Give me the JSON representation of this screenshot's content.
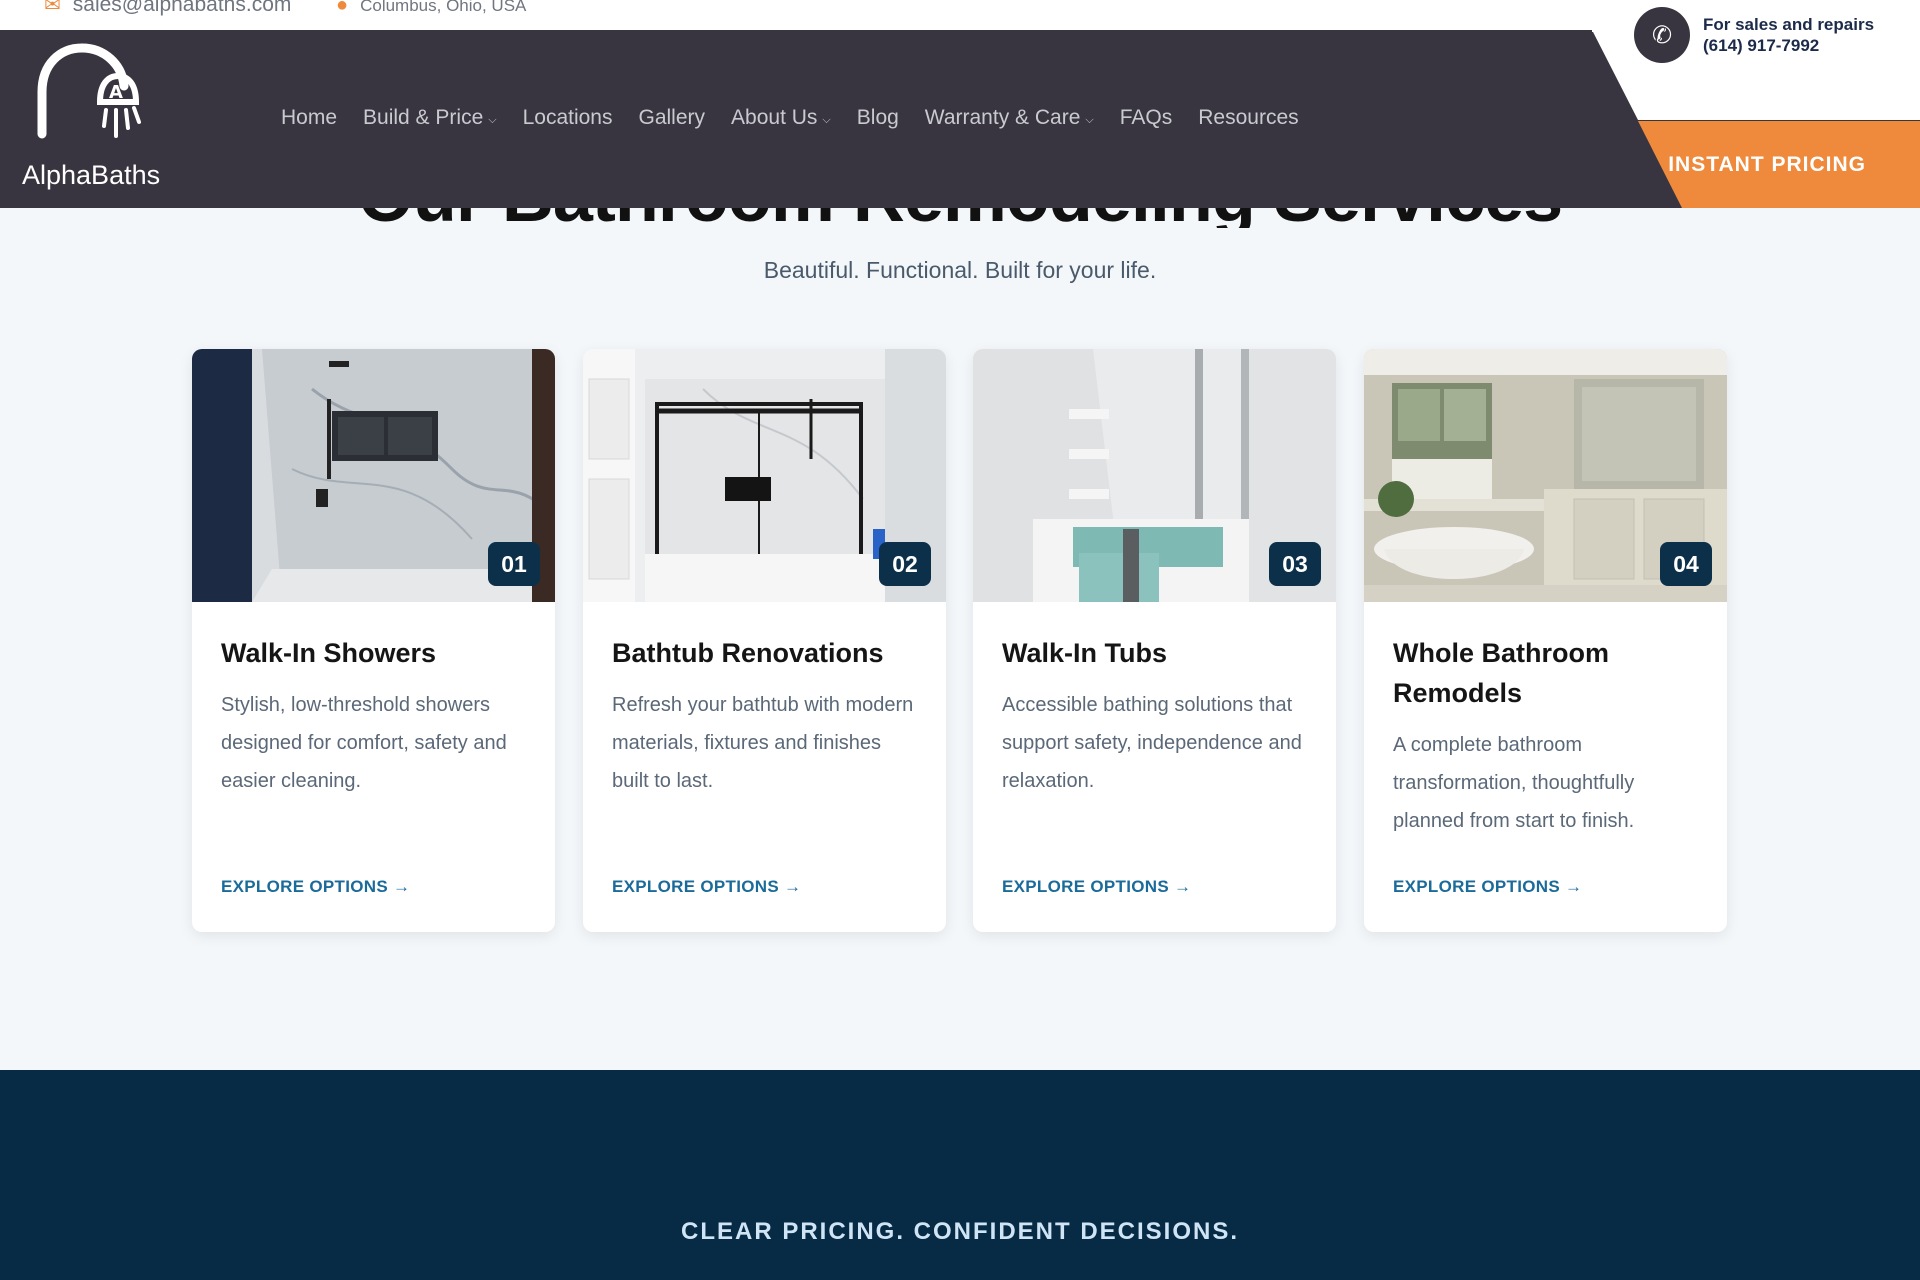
{
  "topbar": {
    "email": "sales@alphabaths.com",
    "location": "Columbus, Ohio, USA"
  },
  "brand": {
    "name": "AlphaBaths"
  },
  "nav": [
    {
      "label": "Home",
      "has_dropdown": false
    },
    {
      "label": "Build & Price",
      "has_dropdown": true
    },
    {
      "label": "Locations",
      "has_dropdown": false
    },
    {
      "label": "Gallery",
      "has_dropdown": false
    },
    {
      "label": "About Us",
      "has_dropdown": true
    },
    {
      "label": "Blog",
      "has_dropdown": false
    },
    {
      "label": "Warranty & Care",
      "has_dropdown": true
    },
    {
      "label": "FAQs",
      "has_dropdown": false
    },
    {
      "label": "Resources",
      "has_dropdown": false
    }
  ],
  "contact": {
    "line1": "For sales and repairs",
    "phone": "(614) 917-7992"
  },
  "cta": {
    "label": "INSTANT PRICING"
  },
  "section": {
    "title": "Our Bathroom Remodeling Services",
    "subtitle": "Beautiful. Functional. Built for your life."
  },
  "cards": [
    {
      "number": "01",
      "title": "Walk-In Showers",
      "description": "Stylish, low-threshold showers designed for comfort, safety and easier cleaning.",
      "link": "EXPLORE OPTIONS →"
    },
    {
      "number": "02",
      "title": "Bathtub Renovations",
      "description": "Refresh your bathtub with modern materials, fixtures and finishes built to last.",
      "link": "EXPLORE OPTIONS →"
    },
    {
      "number": "03",
      "title": "Walk-In Tubs",
      "description": "Accessible bathing solutions that support safety, independence and relaxation.",
      "link": "EXPLORE OPTIONS →"
    },
    {
      "number": "04",
      "title": "Whole Bathroom Remodels",
      "description": "A complete bathroom transformation, thoughtfully planned from start to finish.",
      "link": "EXPLORE OPTIONS →"
    }
  ],
  "bottom": {
    "kicker": "CLEAR PRICING. CONFIDENT DECISIONS."
  },
  "colors": {
    "header_bg": "#393540",
    "accent_orange": "#ef8a3d",
    "navy": "#0c2f4a",
    "link_blue": "#1b6b9a",
    "page_bg": "#f3f7fa"
  },
  "icons": [
    "mail-icon",
    "location-pin-icon",
    "phone-icon",
    "chevron-down-icon",
    "shower-logo-icon"
  ]
}
